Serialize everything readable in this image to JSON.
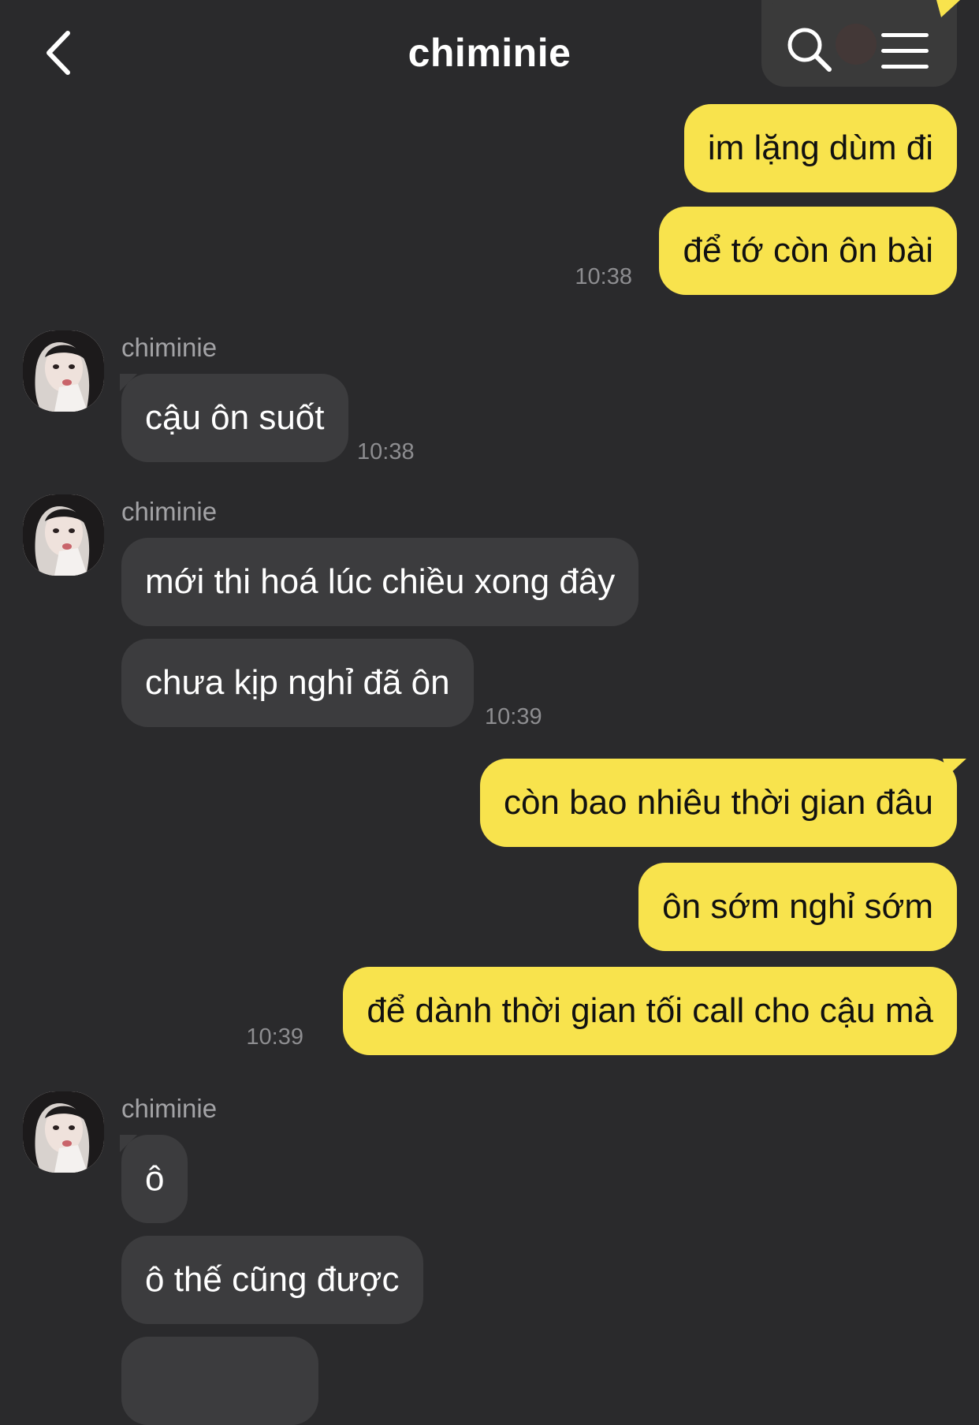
{
  "header": {
    "title": "chiminie",
    "back_icon": "chevron-left-icon",
    "search_icon": "search-icon",
    "menu_icon": "hamburger-menu-icon"
  },
  "colors": {
    "background": "#2a2a2c",
    "my_bubble": "#f8e34d",
    "their_bubble": "#3c3c3e",
    "timestamp": "#8d8d90",
    "header_actions_bg": "#3a3a3a"
  },
  "messages": [
    {
      "from": "me",
      "text": "im lặng dùm đi"
    },
    {
      "from": "me",
      "text": "để tớ còn ôn bài",
      "time": "10:38"
    },
    {
      "from": "chiminie",
      "sender": "chiminie",
      "text": "cậu ôn suốt",
      "time": "10:38"
    },
    {
      "from": "chiminie",
      "sender": "chiminie",
      "text": "mới thi hoá lúc chiều xong đây"
    },
    {
      "from": "chiminie",
      "text": "chưa kịp nghỉ đã ôn",
      "time": "10:39"
    },
    {
      "from": "me",
      "text": "còn bao nhiêu thời gian đâu"
    },
    {
      "from": "me",
      "text": "ôn sớm nghỉ sớm"
    },
    {
      "from": "me",
      "text": "để dành thời gian tối call cho cậu mà",
      "time": "10:39"
    },
    {
      "from": "chiminie",
      "sender": "chiminie",
      "text": "ô"
    },
    {
      "from": "chiminie",
      "text": "ô thế cũng được"
    }
  ]
}
